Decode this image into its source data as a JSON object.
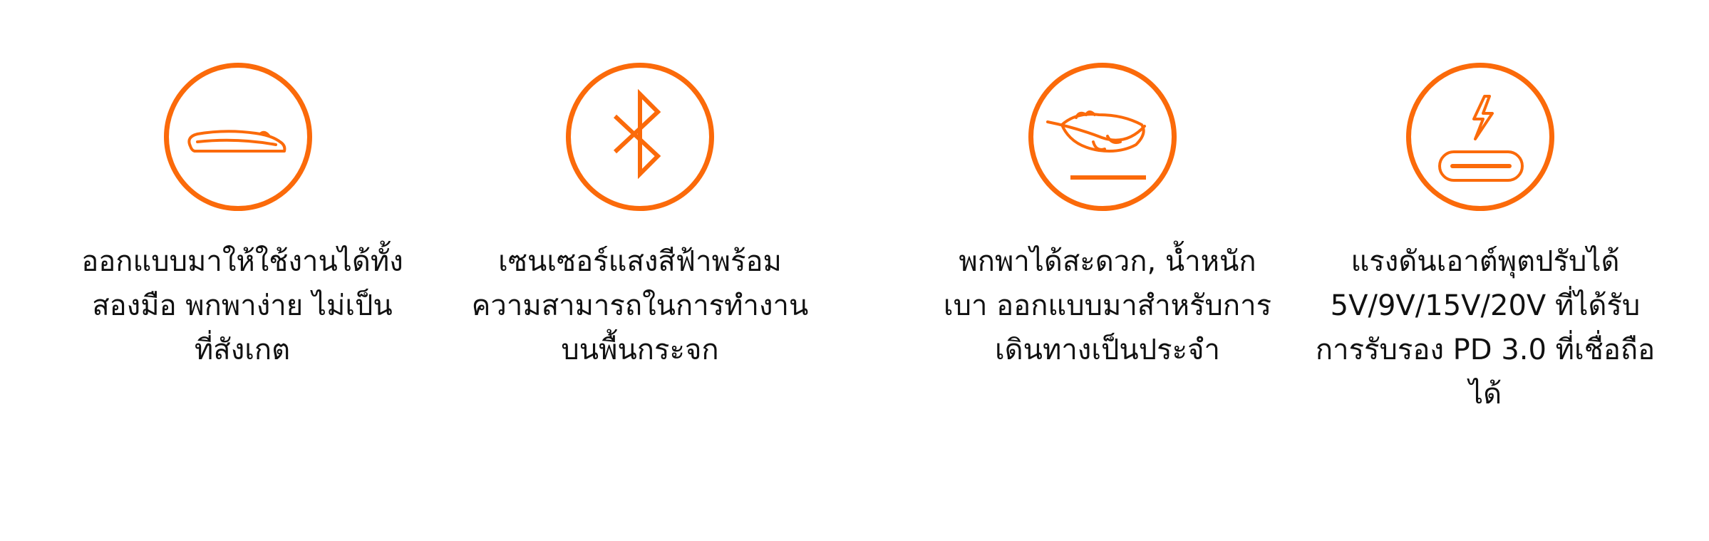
{
  "accent_color": "#fb6a0a",
  "features": [
    {
      "icon": "slim-mouse-icon",
      "lines": [
        "ออกแบบมาให้ใช้งานได้ทั้ง",
        "สองมือ พกพาง่าย ไม่เป็น",
        "ที่สังเกต"
      ]
    },
    {
      "icon": "bluetooth-icon",
      "lines": [
        "เซนเซอร์แสงสีฟ้าพร้อม",
        "ความสามารถในการทำงาน",
        "บนพื้นกระจก"
      ]
    },
    {
      "icon": "feather-icon",
      "lines": [
        "พกพาได้สะดวก, น้ำหนัก",
        "เบา ออกแบบมาสำหรับการ",
        "เดินทางเป็นประจำ"
      ]
    },
    {
      "icon": "usb-c-charging-icon",
      "lines": [
        "แรงดันเอาต์พุตปรับได้",
        "5V/9V/15V/20V ที่ได้รับ",
        "การรับรอง PD 3.0 ที่เชื่อถือ",
        "ได้"
      ]
    }
  ]
}
